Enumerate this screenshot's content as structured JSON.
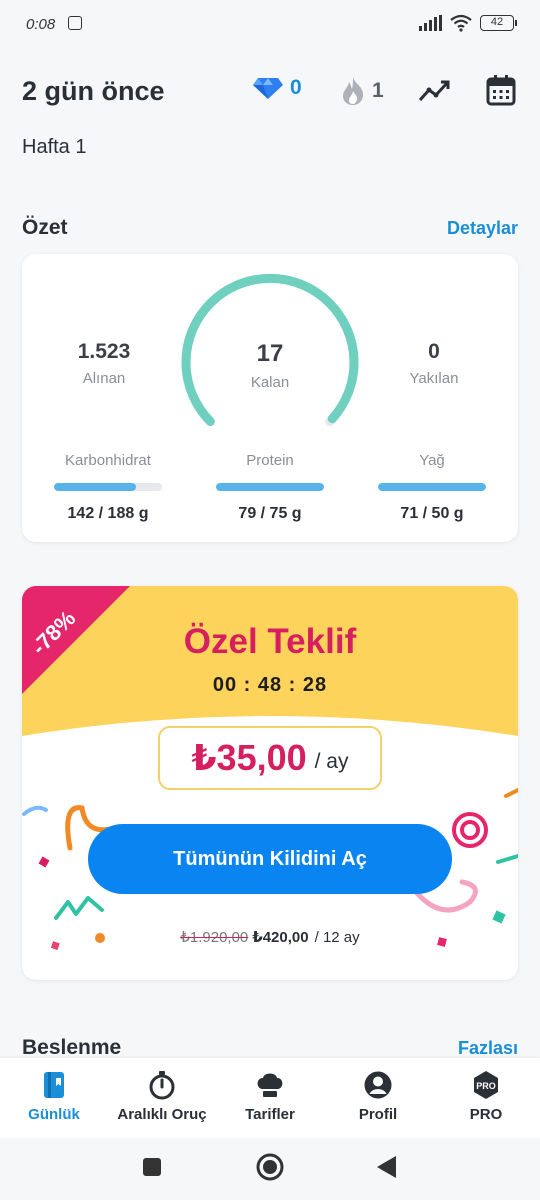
{
  "status_bar": {
    "time": "0:08",
    "battery": "42"
  },
  "header": {
    "title": "2 gün önce",
    "gems": "0",
    "streak": "1",
    "week": "Hafta 1"
  },
  "summary": {
    "title": "Özet",
    "details_link": "Detaylar",
    "eaten_value": "1.523",
    "eaten_label": "Alınan",
    "remaining_value": "17",
    "remaining_label": "Kalan",
    "burned_value": "0",
    "burned_label": "Yakılan",
    "gauge_progress": 0.99,
    "macros": [
      {
        "label": "Karbonhidrat",
        "value": "142 / 188 g",
        "progress": 0.76
      },
      {
        "label": "Protein",
        "value": "79 / 75 g",
        "progress": 1.0
      },
      {
        "label": "Yağ",
        "value": "71 / 50 g",
        "progress": 1.0
      }
    ]
  },
  "offer": {
    "discount": "-78%",
    "title": "Özel Teklif",
    "timer": "00 : 48 : 28",
    "price": "₺35,00",
    "per": "/ ay",
    "button": "Tümünün Kilidini Aç",
    "old_price": "₺1.920,00",
    "new_price": "₺420,00",
    "period": "/ 12 ay",
    "accent": "#d61f5e",
    "banner_color": "#fdd35c"
  },
  "nutrition": {
    "title": "Beslenme",
    "more_link": "Fazlası"
  },
  "tabs": [
    {
      "label": "Günlük",
      "icon": "journal-icon",
      "active": true
    },
    {
      "label": "Aralıklı Oruç",
      "icon": "stopwatch-icon",
      "active": false
    },
    {
      "label": "Tarifler",
      "icon": "chef-hat-icon",
      "active": false
    },
    {
      "label": "Profil",
      "icon": "profile-icon",
      "active": false
    },
    {
      "label": "PRO",
      "icon": "pro-badge-icon",
      "active": false
    }
  ]
}
